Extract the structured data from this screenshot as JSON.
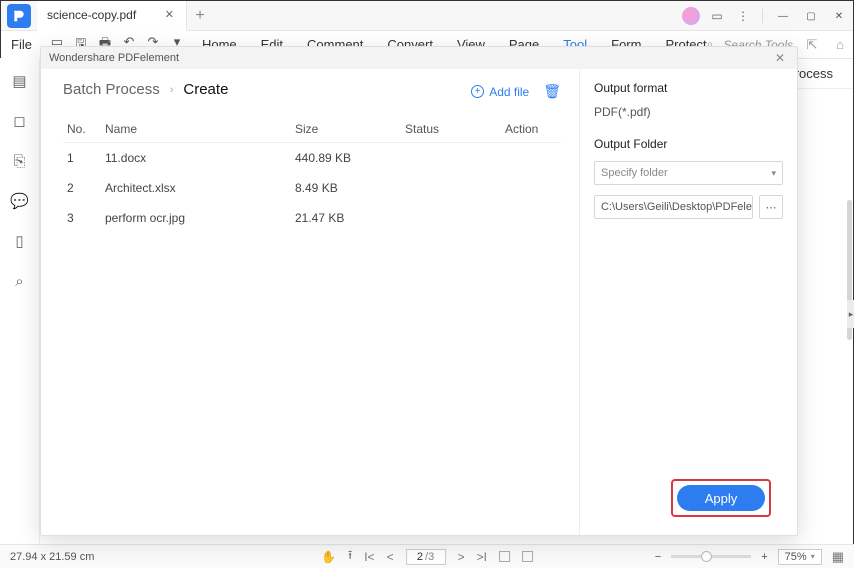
{
  "title_tab": {
    "label": "science-copy.pdf"
  },
  "menu": {
    "file": "File",
    "items": [
      "Home",
      "Edit",
      "Comment",
      "Convert",
      "View",
      "Page",
      "Tool",
      "Form",
      "Protect"
    ],
    "active_index": 6,
    "search_placeholder": "Search Tools"
  },
  "strip": {
    "process": "Process"
  },
  "modal": {
    "frame_title": "Wondershare PDFelement",
    "crumb_root": "Batch Process",
    "crumb_current": "Create",
    "add_file": "Add file",
    "table": {
      "headers": {
        "no": "No.",
        "name": "Name",
        "size": "Size",
        "status": "Status",
        "action": "Action"
      },
      "rows": [
        {
          "no": "1",
          "name": "11.docx",
          "size": "440.89 KB",
          "status": "",
          "action": ""
        },
        {
          "no": "2",
          "name": "Architect.xlsx",
          "size": "8.49 KB",
          "status": "",
          "action": ""
        },
        {
          "no": "3",
          "name": "perform ocr.jpg",
          "size": "21.47 KB",
          "status": "",
          "action": ""
        }
      ]
    },
    "right": {
      "format_label": "Output format",
      "format_value": "PDF(*.pdf)",
      "folder_label": "Output Folder",
      "folder_placeholder": "Specify folder",
      "folder_path": "C:\\Users\\Geili\\Desktop\\PDFelement\\Cr"
    },
    "apply": "Apply"
  },
  "status": {
    "dims": "27.94 x 21.59 cm",
    "page_current": "2",
    "page_total": "/3",
    "zoom": "75%"
  }
}
